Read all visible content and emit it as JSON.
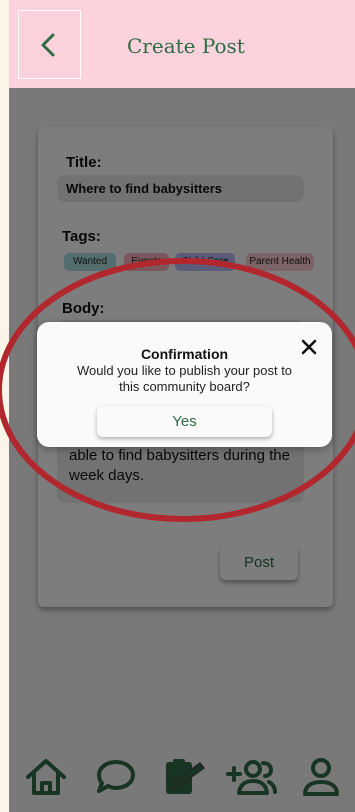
{
  "header": {
    "title": "Create Post",
    "back_icon": "chevron-left-icon"
  },
  "form": {
    "title_label": "Title:",
    "title_value": "Where to find babysitters",
    "tags_label": "Tags:",
    "tags": [
      {
        "label": "Wanted",
        "color": "#a9dde0"
      },
      {
        "label": "Events",
        "color": "#f3aeb9"
      },
      {
        "label": "Child Care",
        "color": "#b7b7f5"
      },
      {
        "label": "Parent Health",
        "color": "#f6c7cf"
      }
    ],
    "body_label": "Body:",
    "body_value": "able to find babysitters during the week days.",
    "post_label": "Post"
  },
  "dialog": {
    "title": "Confirmation",
    "message": "Would you like to publish your post to this community board?",
    "yes_label": "Yes",
    "close_icon": "close-icon"
  },
  "nav": {
    "items": [
      {
        "icon": "home-icon"
      },
      {
        "icon": "chat-icon"
      },
      {
        "icon": "create-post-icon"
      },
      {
        "icon": "add-friends-icon"
      },
      {
        "icon": "profile-icon"
      }
    ]
  },
  "colors": {
    "accent": "#2f6b45",
    "header_bg": "#fcd3dc",
    "annotation": "#b2262d"
  }
}
